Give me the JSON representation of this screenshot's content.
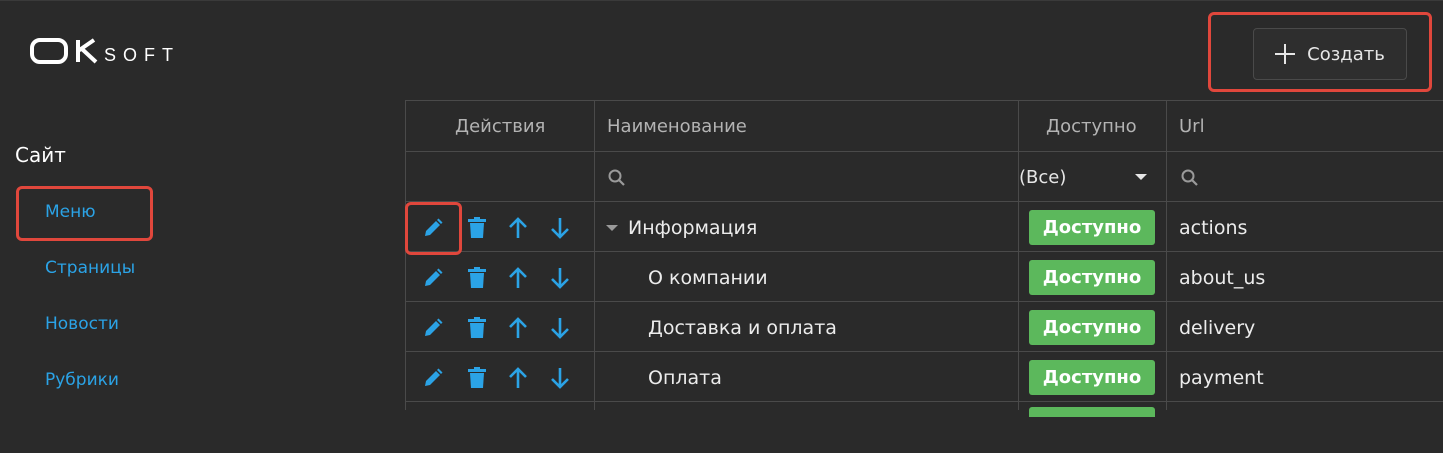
{
  "app": {
    "logo_text": "OKsoft"
  },
  "header": {
    "create_label": "Создать"
  },
  "colors": {
    "accent": "#2ba3e6",
    "badge": "#5cb85c",
    "highlight": "#e0473c",
    "background": "#2a2a2a"
  },
  "sidebar": {
    "section_title": "Сайт",
    "items": [
      {
        "label": "Меню"
      },
      {
        "label": "Страницы"
      },
      {
        "label": "Новости"
      },
      {
        "label": "Рубрики"
      }
    ]
  },
  "table": {
    "columns": {
      "actions": "Действия",
      "name": "Наименование",
      "available": "Доступно",
      "url": "Url"
    },
    "filters": {
      "available_value": "(Все)"
    },
    "action_icons": [
      "edit-icon",
      "delete-icon",
      "arrow-up-icon",
      "arrow-down-icon"
    ],
    "rows": [
      {
        "name": "Информация",
        "status": "Доступно",
        "url": "actions"
      },
      {
        "name": "О компании",
        "status": "Доступно",
        "url": "about_us"
      },
      {
        "name": "Доставка и оплата",
        "status": "Доступно",
        "url": "delivery"
      },
      {
        "name": "Оплата",
        "status": "Доступно",
        "url": "payment"
      }
    ]
  }
}
